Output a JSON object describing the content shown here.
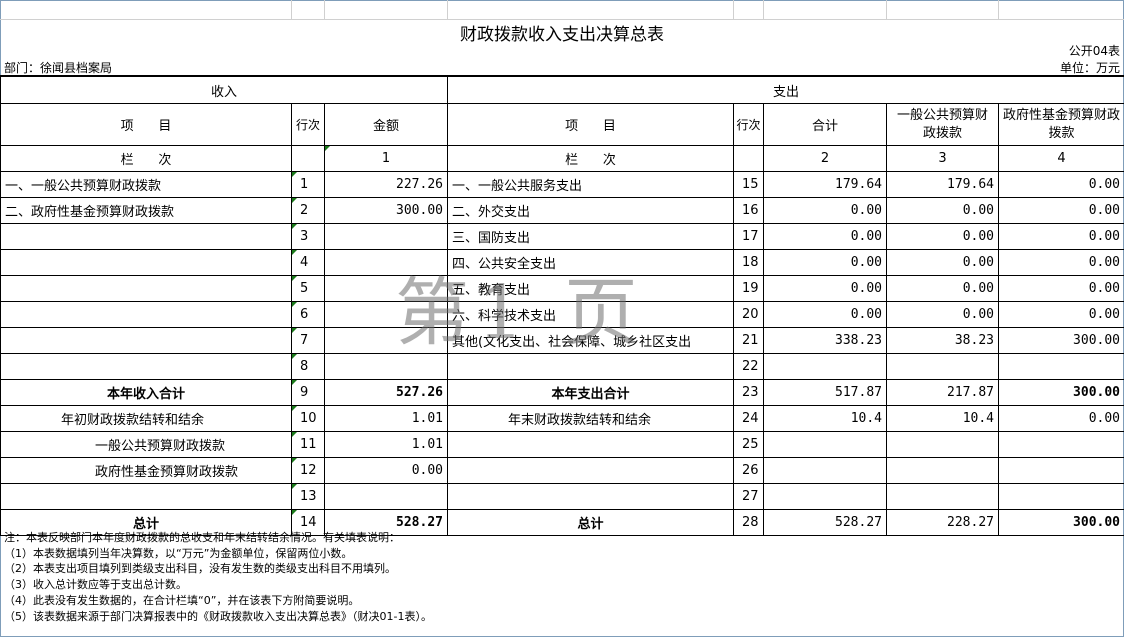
{
  "header": {
    "title": "财政拨款收入支出决算总表",
    "code": "公开04表",
    "department": "部门：徐闻县档案局",
    "unit": "单位：万元"
  },
  "section": {
    "income": "收入",
    "expense": "支出"
  },
  "columns": {
    "item": "项      目",
    "row_no": "行次",
    "amount": "金额",
    "total": "合计",
    "general": "一般公共预算财政拨款",
    "fund": "政府性基金预算财政拨款"
  },
  "colnum": {
    "label": "栏      次",
    "c1": "1",
    "c2": "2",
    "c3": "3",
    "c4": "4"
  },
  "rows": [
    {
      "in_item": "一、一般公共预算财政拨款",
      "in_no": "1",
      "in_amt": "227.26",
      "out_item": "一、一般公共服务支出",
      "out_no": "15",
      "total": "179.64",
      "general": "179.64",
      "fund": "0.00"
    },
    {
      "in_item": "二、政府性基金预算财政拨款",
      "in_no": "2",
      "in_amt": "300.00",
      "out_item": "二、外交支出",
      "out_no": "16",
      "total": "0.00",
      "general": "0.00",
      "fund": "0.00"
    },
    {
      "in_item": "",
      "in_no": "3",
      "in_amt": "",
      "out_item": "三、国防支出",
      "out_no": "17",
      "total": "0.00",
      "general": "0.00",
      "fund": "0.00"
    },
    {
      "in_item": "",
      "in_no": "4",
      "in_amt": "",
      "out_item": "四、公共安全支出",
      "out_no": "18",
      "total": "0.00",
      "general": "0.00",
      "fund": "0.00"
    },
    {
      "in_item": "",
      "in_no": "5",
      "in_amt": "",
      "out_item": "五、教育支出",
      "out_no": "19",
      "total": "0.00",
      "general": "0.00",
      "fund": "0.00"
    },
    {
      "in_item": "",
      "in_no": "6",
      "in_amt": "",
      "out_item": "六、科学技术支出",
      "out_no": "20",
      "total": "0.00",
      "general": "0.00",
      "fund": "0.00"
    },
    {
      "in_item": "",
      "in_no": "7",
      "in_amt": "",
      "out_item": "其他(文化支出、社会保障、城乡社区支出",
      "out_no": "21",
      "total": "338.23",
      "general": "38.23",
      "fund": "300.00"
    },
    {
      "in_item": "",
      "in_no": "8",
      "in_amt": "",
      "out_item": "",
      "out_no": "22",
      "total": "",
      "general": "",
      "fund": ""
    },
    {
      "in_item": "本年收入合计",
      "in_no": "9",
      "in_amt": "527.26",
      "out_item": "本年支出合计",
      "out_no": "23",
      "total": "517.87",
      "general": "217.87",
      "fund": "300.00",
      "bold": true
    },
    {
      "in_item": "年初财政拨款结转和结余",
      "in_no": "10",
      "in_amt": "1.01",
      "out_item": "年末财政拨款结转和结余",
      "out_no": "24",
      "total": "10.4",
      "general": "10.4",
      "fund": "0.00"
    },
    {
      "in_item": "一般公共预算财政拨款",
      "in_no": "11",
      "in_amt": "1.01",
      "out_item": "",
      "out_no": "25",
      "total": "",
      "general": "",
      "fund": ""
    },
    {
      "in_item": "政府性基金预算财政拨款",
      "in_no": "12",
      "in_amt": "0.00",
      "out_item": "",
      "out_no": "26",
      "total": "",
      "general": "",
      "fund": ""
    },
    {
      "in_item": "",
      "in_no": "13",
      "in_amt": "",
      "out_item": "",
      "out_no": "27",
      "total": "",
      "general": "",
      "fund": ""
    },
    {
      "in_item": "总计",
      "in_no": "14",
      "in_amt": "528.27",
      "out_item": "总计",
      "out_no": "28",
      "total": "528.27",
      "general": "228.27",
      "fund": "300.00",
      "bold": true
    }
  ],
  "notes": [
    "注：本表反映部门本年度财政拨款的总收支和年末结转结余情况。有关填表说明：",
    "（1）本表数据填列当年决算数，以“万元”为金额单位，保留两位小数。",
    "（2）本表支出项目填列到类级支出科目，没有发生数的类级支出科目不用填列。",
    "（3）收入总计数应等于支出总计数。",
    "（4）此表没有发生数据的，在合计栏填“0”，并在该表下方附简要说明。",
    "（5）该表数据来源于部门决算报表中的《财政拨款收入支出决算总表》（财决01-1表）。"
  ],
  "watermark": "第1 页"
}
